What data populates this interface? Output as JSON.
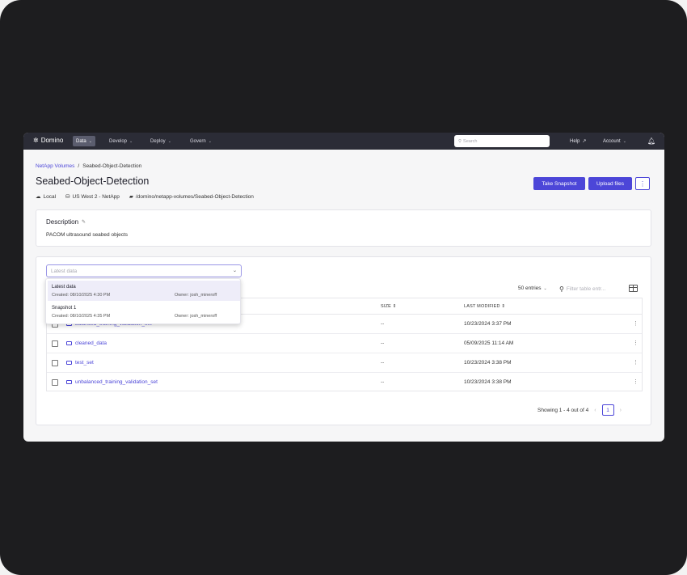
{
  "colors": {
    "accent": "#4c46d8",
    "nav_bg": "#2b2c36",
    "frame_bg": "#1d1d1f"
  },
  "nav": {
    "logo": "Domino",
    "items": [
      {
        "label": "Data",
        "active": true
      },
      {
        "label": "Develop",
        "active": false
      },
      {
        "label": "Deploy",
        "active": false
      },
      {
        "label": "Govern",
        "active": false
      }
    ],
    "search_placeholder": "Search",
    "help": "Help",
    "account": "Account"
  },
  "breadcrumb": {
    "parent": "NetApp Volumes",
    "separator": "/",
    "current": "Seabed-Object-Detection"
  },
  "header": {
    "title": "Seabed-Object-Detection",
    "location": "Local",
    "region": "US West 2 - NetApp",
    "path": "/domino/netapp-volumes/Seabed-Object-Detection",
    "snapshot_button": "Take Snapshot",
    "upload_button": "Upload files",
    "more_button": "⋮"
  },
  "description": {
    "title": "Description",
    "body": "PACOM ultrasound seabed objects"
  },
  "snapshot_select": {
    "placeholder": "Latest data",
    "options": [
      {
        "name": "Latest data",
        "created": "Created: 08/10/2025 4:30 PM",
        "owner": "Owner: josh_mineroff",
        "selected": true
      },
      {
        "name": "Snapshot 1",
        "created": "Created: 08/10/2025 4:35 PM",
        "owner": "Owner: josh_mineroff",
        "selected": false
      }
    ]
  },
  "table": {
    "entries": "50 entries",
    "filter_placeholder": "Filter table entr...",
    "columns": {
      "size": "SIZE",
      "last_modified": "LAST MODIFIED"
    },
    "rows": [
      {
        "name": "balanced_training_validation_set",
        "size": "--",
        "modified": "10/23/2024 3:37 PM"
      },
      {
        "name": "cleaned_data",
        "size": "--",
        "modified": "05/09/2025 11:14 AM"
      },
      {
        "name": "test_set",
        "size": "--",
        "modified": "10/23/2024 3:38 PM"
      },
      {
        "name": "unbalanced_training_validation_set",
        "size": "--",
        "modified": "10/23/2024 3:38 PM"
      }
    ]
  },
  "pagination": {
    "summary": "Showing 1 - 4 out of 4",
    "page": "1",
    "prev": "‹",
    "next": "›"
  }
}
